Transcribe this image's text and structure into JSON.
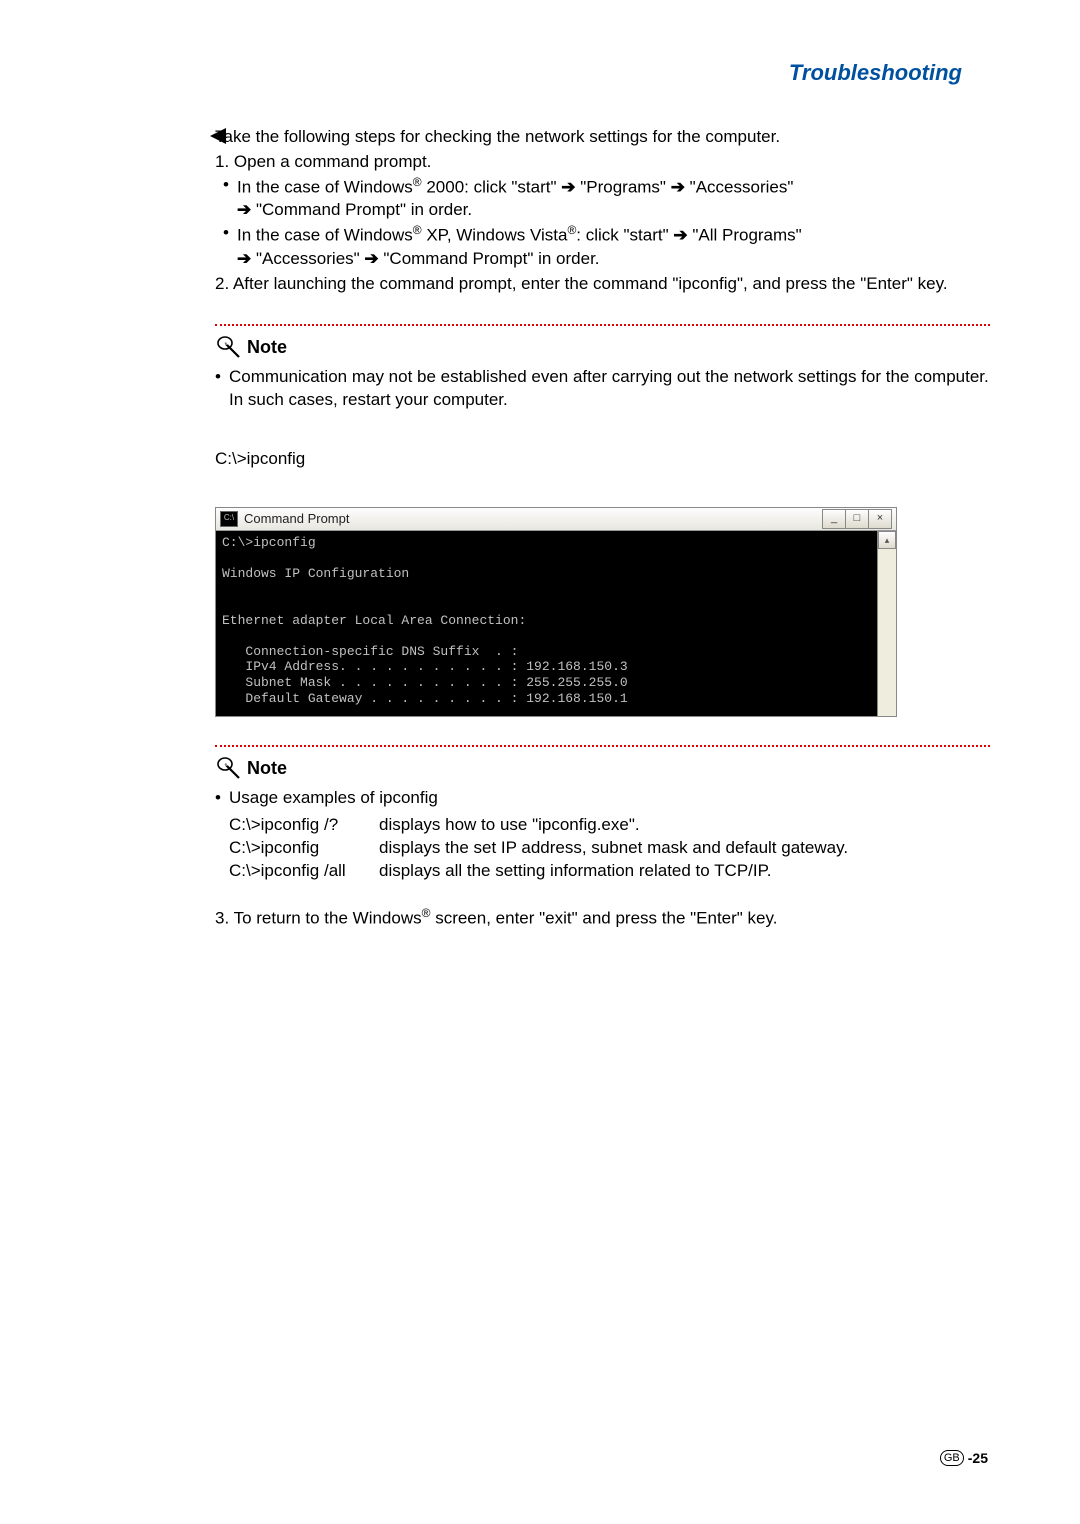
{
  "header": {
    "title": "Troubleshooting"
  },
  "intro": "Take the following steps for checking the network settings for the computer.",
  "step1": {
    "text": "1. Open a command prompt.",
    "b1a": "In the case of Windows",
    "b1b": " 2000: click \"start\" ",
    "b1c": " \"Programs\" ",
    "b1d": " \"Accessories\"",
    "b1e": " \"Command Prompt\" in order.",
    "b2a": "In the case of Windows",
    "b2b": " XP, Windows Vista",
    "b2c": ": click \"start\" ",
    "b2d": " \"All Programs\"",
    "b2e": " \"Accessories\" ",
    "b2f": " \"Command Prompt\" in order."
  },
  "step2": "2. After launching the command prompt, enter the command \"ipconfig\", and press the \"Enter\" key.",
  "note1": {
    "label": "Note",
    "text": "Communication may not be established even after carrying out the network settings for the computer. In such cases, restart your computer."
  },
  "cmd_label": "C:\\>ipconfig",
  "cmd_window": {
    "title": "Command Prompt",
    "icon_text": "C:\\",
    "minimize": "_",
    "maximize": "□",
    "close": "×",
    "scroll_up": "▴",
    "body": "C:\\>ipconfig\n\nWindows IP Configuration\n\n\nEthernet adapter Local Area Connection:\n\n   Connection-specific DNS Suffix  . :\n   IPv4 Address. . . . . . . . . . . : 192.168.150.3\n   Subnet Mask . . . . . . . . . . . : 255.255.255.0\n   Default Gateway . . . . . . . . . : 192.168.150.1"
  },
  "note2": {
    "label": "Note",
    "heading": "Usage examples of ipconfig",
    "rows": [
      {
        "cmd": "C:\\>ipconfig /?",
        "desc": "displays how to use \"ipconfig.exe\"."
      },
      {
        "cmd": "C:\\>ipconfig",
        "desc": "displays the set IP address, subnet mask and default gateway."
      },
      {
        "cmd": "C:\\>ipconfig /all",
        "desc": "displays all the setting information related to TCP/IP."
      }
    ]
  },
  "step3a": "3. To return to the Windows",
  "step3b": " screen, enter \"exit\" and press the \"Enter\" key.",
  "footer": {
    "region": "GB",
    "page": "-25"
  },
  "glyphs": {
    "arrow": "➔",
    "reg": "®"
  }
}
